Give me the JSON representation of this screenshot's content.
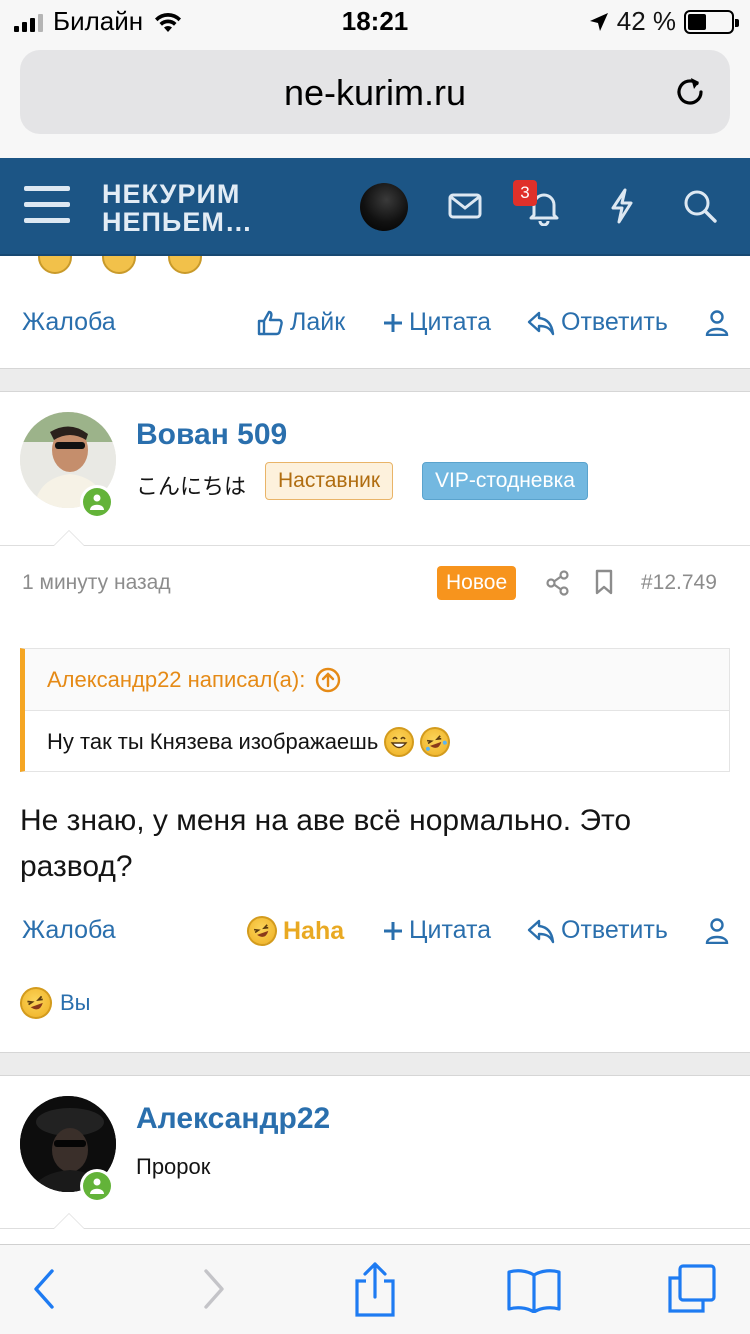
{
  "status_bar": {
    "carrier": "Билайн",
    "time": "18:21",
    "battery_percent": "42 %",
    "battery_level": 0.42
  },
  "browser": {
    "url": "ne-kurim.ru"
  },
  "site_header": {
    "logo_line1": "НЕКУРИМ",
    "logo_line2": "НЕПЬЕМ…",
    "notification_count": "3"
  },
  "prev_post_actions": {
    "report": "Жалоба",
    "like": "Лайк",
    "quote": "Цитата",
    "reply": "Ответить"
  },
  "post": {
    "username": "Вован 509",
    "user_title": "こんにちは",
    "badge_mentor": "Наставник",
    "badge_vip": "VIP-стодневка",
    "time_ago": "1 минуту назад",
    "new_label": "Новое",
    "post_number": "#12.749",
    "quote_author": "Александр22 написал(а):",
    "quote_text": "Ну так ты Князева изображаешь",
    "message": "Не знаю, у меня на аве всё нормально. Это развод?",
    "actions": {
      "report": "Жалоба",
      "reaction": "Haha",
      "quote": "Цитата",
      "reply": "Ответить"
    },
    "reacted_by": "Вы"
  },
  "next_post": {
    "username": "Александр22",
    "user_title": "Пророк"
  },
  "colors": {
    "header_blue": "#1c5585",
    "link_blue": "#2a6fad",
    "accent_orange": "#f7941d",
    "online_green": "#63b339"
  }
}
